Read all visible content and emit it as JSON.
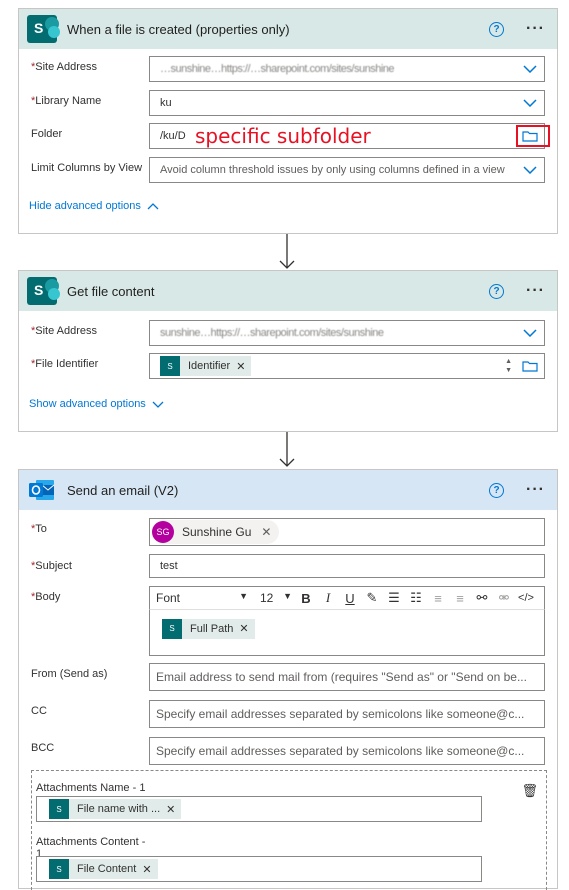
{
  "card1": {
    "title": "When a file is created (properties only)",
    "fields": {
      "site_address": {
        "label": "Site Address",
        "value": "…sunshine…https://…sharepoint.com/sites/sunshine"
      },
      "library_name": {
        "label": "Library Name",
        "value": "ku"
      },
      "folder": {
        "label": "Folder",
        "value": "/ku/D"
      },
      "limit_columns": {
        "label": "Limit Columns by View",
        "placeholder": "Avoid column threshold issues by only using columns defined in a view"
      }
    },
    "advanced_link": "Hide advanced options"
  },
  "annotation": "specific subfolder",
  "card2": {
    "title": "Get file content",
    "fields": {
      "site_address": {
        "label": "Site Address",
        "value": "sunshine…https://…sharepoint.com/sites/sunshine"
      },
      "file_identifier": {
        "label": "File Identifier",
        "token": "Identifier"
      }
    },
    "advanced_link": "Show advanced options"
  },
  "card3": {
    "title": "Send an email (V2)",
    "fields": {
      "to": {
        "label": "To",
        "recipient_initials": "SG",
        "recipient_name": "Sunshine Gu"
      },
      "subject": {
        "label": "Subject",
        "value": "test"
      },
      "body": {
        "label": "Body",
        "font": "Font",
        "size": "12",
        "token": "Full Path"
      },
      "from": {
        "label": "From (Send as)",
        "placeholder": "Email address to send mail from (requires \"Send as\" or \"Send on be..."
      },
      "cc": {
        "label": "CC",
        "placeholder": "Specify email addresses separated by semicolons like someone@c..."
      },
      "bcc": {
        "label": "BCC",
        "placeholder": "Specify email addresses separated by semicolons like someone@c..."
      }
    },
    "attachments": {
      "name_label": "Attachments Name - 1",
      "name_token": "File name with ...",
      "content_label": "Attachments Content -",
      "content_label_2": "1",
      "content_token": "File Content"
    }
  },
  "colors": {
    "accent": "#0078d4",
    "required": "#a4262c",
    "sharepoint": "#036c70",
    "annotation": "#e81123"
  }
}
